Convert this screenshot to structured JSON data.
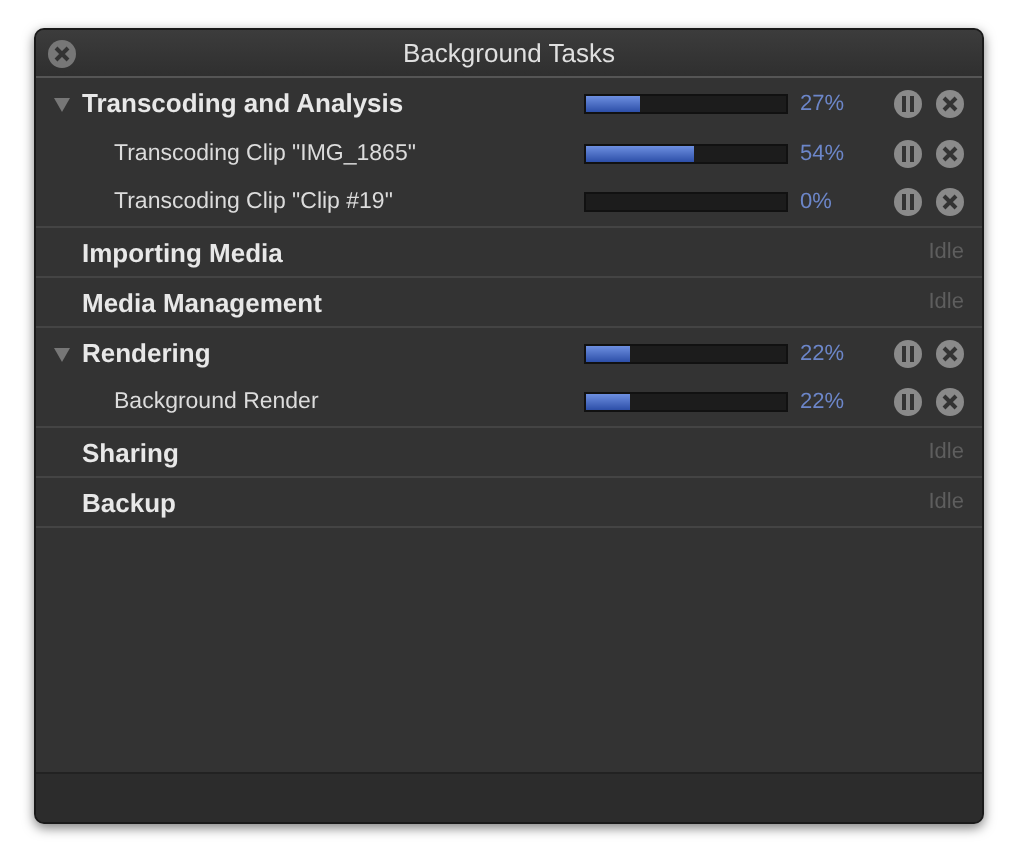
{
  "window": {
    "title": "Background Tasks"
  },
  "groups": [
    {
      "name": "Transcoding and Analysis",
      "kind": "progress",
      "expanded": true,
      "level": 0.27,
      "reading": "27%",
      "children": [
        {
          "name": "Transcoding Clip \"IMG_1865\"",
          "kind": "progress",
          "level": 0.54,
          "reading": "54%"
        },
        {
          "name": "Transcoding Clip \"Clip #19\"",
          "kind": "progress",
          "reading": "0%"
        }
      ]
    },
    {
      "name": "Importing Media",
      "kind": "idle",
      "status": "Idle"
    },
    {
      "name": "Media Management",
      "kind": "idle",
      "status": "Idle"
    },
    {
      "name": "Rendering",
      "kind": "progress",
      "expanded": true,
      "level": 0.22,
      "reading": "22%",
      "children": [
        {
          "name": "Background Render",
          "kind": "progress",
          "level": 0.22,
          "reading": "22%"
        }
      ]
    },
    {
      "name": "Sharing",
      "kind": "idle",
      "status": "Idle"
    },
    {
      "name": "Backup",
      "kind": "idle",
      "status": "Idle"
    }
  ]
}
